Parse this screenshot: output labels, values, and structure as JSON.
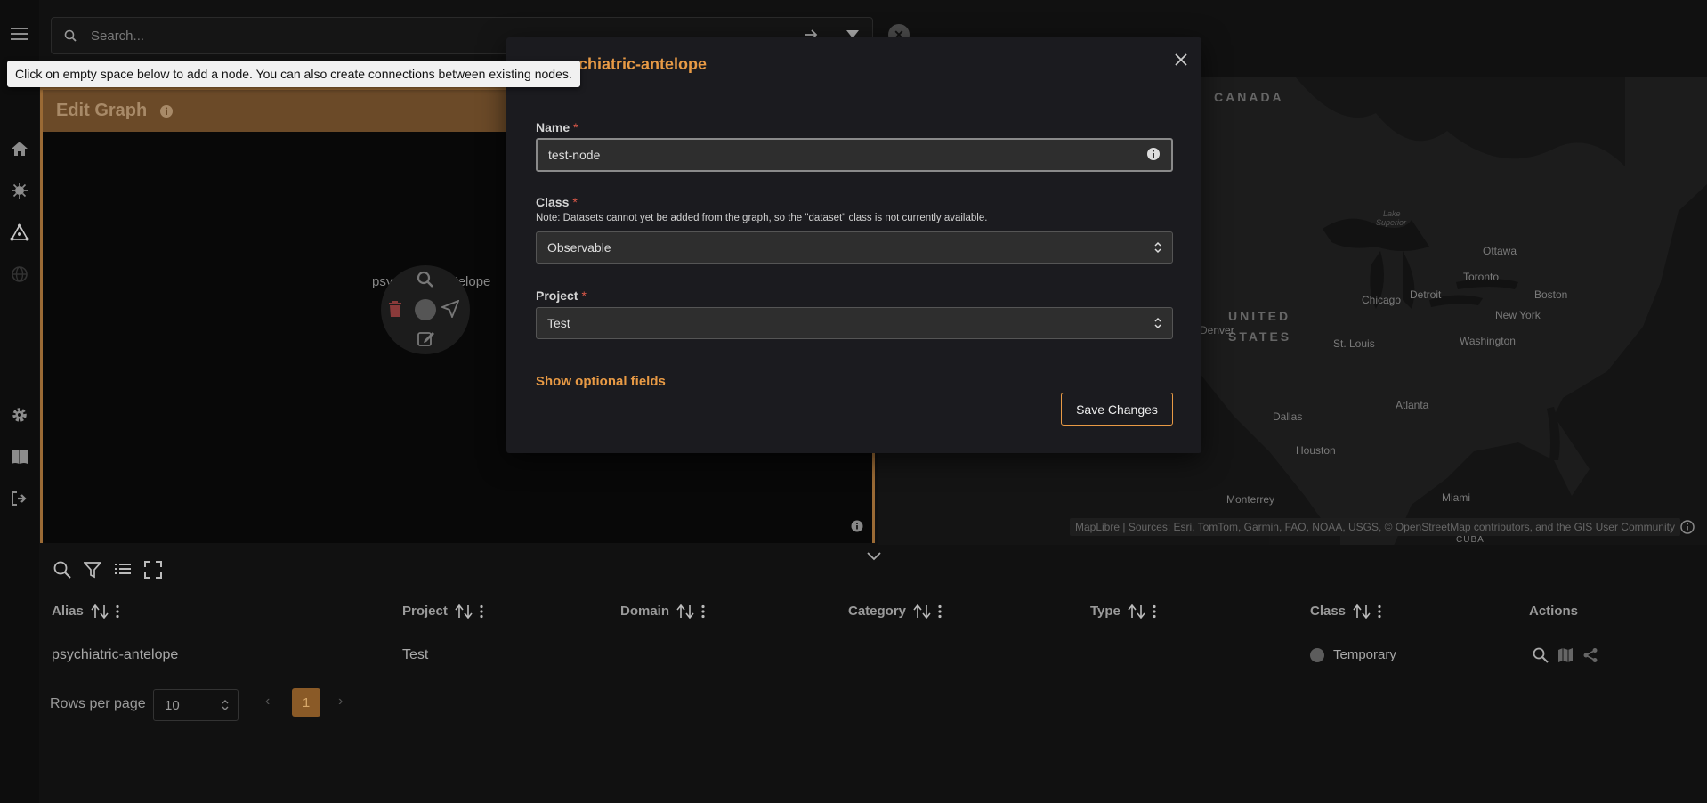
{
  "topbar": {
    "search_placeholder": "Search..."
  },
  "tooltip": {
    "text": "Click on empty space below to add a node. You can also create connections between existing nodes."
  },
  "graph": {
    "title": "Edit Graph",
    "node_label": "psychiatric-antelope"
  },
  "modal": {
    "title": "psychiatric-antelope",
    "name_label": "Name",
    "name_value": "test-node",
    "class_label": "Class",
    "class_note": "Note: Datasets cannot yet be added from the graph, so the \"dataset\" class is not currently available.",
    "class_value": "Observable",
    "project_label": "Project",
    "project_value": "Test",
    "required_mark": "*",
    "show_optional": "Show optional fields",
    "save_label": "Save Changes"
  },
  "map": {
    "labels": {
      "canada": "CANADA",
      "united": "UNITED",
      "states": "STATES",
      "lake_superior_1": "Lake",
      "lake_superior_2": "Superior",
      "ottawa": "Ottawa",
      "toronto": "Toronto",
      "boston": "Boston",
      "chicago": "Chicago",
      "detroit": "Detroit",
      "new_york": "New York",
      "washington": "Washington",
      "st_louis": "St. Louis",
      "denver": "Denver",
      "atlanta": "Atlanta",
      "dallas": "Dallas",
      "houston": "Houston",
      "monterrey": "Monterrey",
      "miami": "Miami",
      "cuba": "CUBA"
    },
    "attribution": "MapLibre | Sources: Esri, TomTom, Garmin, FAO, NOAA, USGS, © OpenStreetMap contributors, and the GIS User Community"
  },
  "table": {
    "columns": {
      "alias": "Alias",
      "project": "Project",
      "domain": "Domain",
      "category": "Category",
      "type": "Type",
      "class": "Class",
      "actions": "Actions"
    },
    "rows": [
      {
        "alias": "psychiatric-antelope",
        "project": "Test",
        "domain": "",
        "category": "",
        "type": "",
        "class": "Temporary"
      }
    ]
  },
  "pagination": {
    "rows_per_page_label": "Rows per page",
    "rows_per_page": "10",
    "prev": "‹",
    "next": "›",
    "current_page": "1"
  },
  "colors": {
    "accent": "#e89a45",
    "graph_border": "#9a6a35",
    "graph_header": "#6b4a28",
    "page_active": "#8a5a27"
  }
}
